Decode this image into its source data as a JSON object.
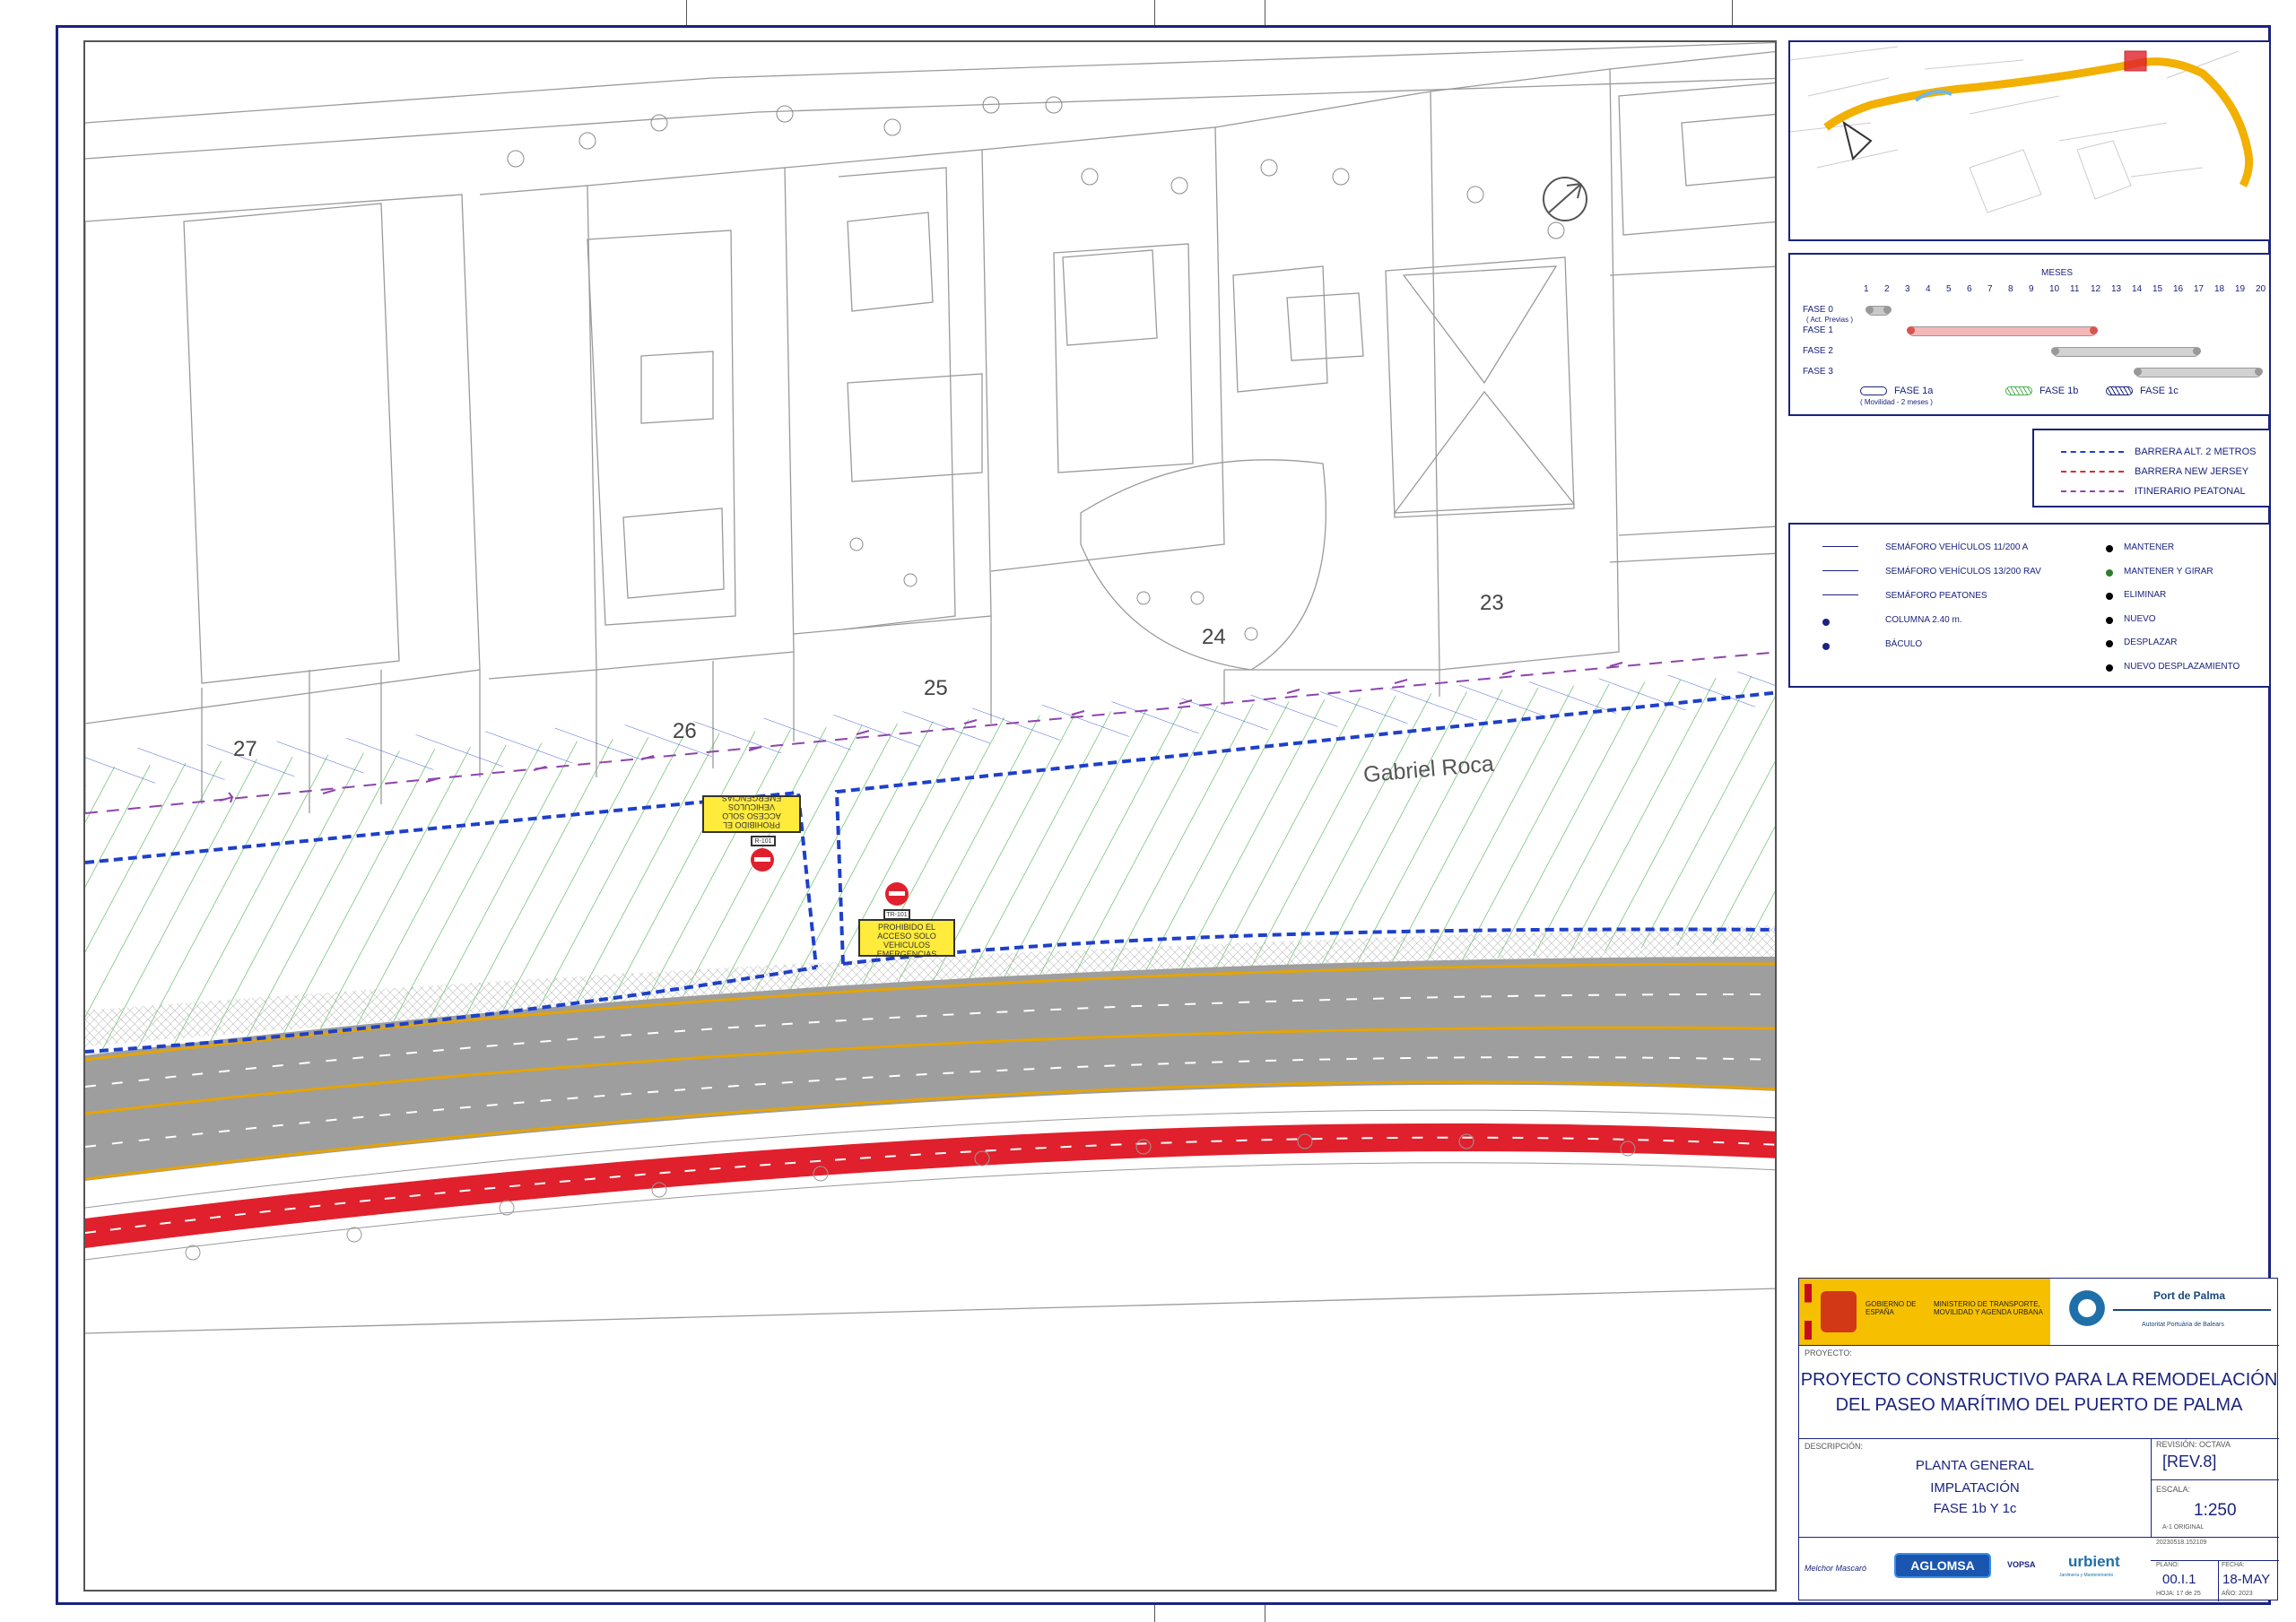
{
  "plan": {
    "lot_labels": [
      "27",
      "26",
      "25",
      "24",
      "23"
    ],
    "street_name": "Gabriel Roca",
    "signs": [
      {
        "code": "R-101",
        "text": "PROHIBIDO EL ACCESO SOLO VEHICULOS EMERGENCIAS"
      },
      {
        "code": "TR-101",
        "text": "PROHIBIDO EL ACCESO SOLO VEHICULOS EMERGENCIAS"
      }
    ]
  },
  "schedule": {
    "months_label": "MESES",
    "months": [
      "1",
      "2",
      "3",
      "4",
      "5",
      "6",
      "7",
      "8",
      "9",
      "10",
      "11",
      "12",
      "13",
      "14",
      "15",
      "16",
      "17",
      "18",
      "19",
      "20"
    ],
    "phases": [
      {
        "label": "FASE 0",
        "sub": "( Act. Previas )",
        "start": 1,
        "end": 2,
        "color": "#c9c9c9"
      },
      {
        "label": "FASE 1",
        "sub": "",
        "start": 3,
        "end": 12,
        "color": "#f2b8b8"
      },
      {
        "label": "FASE 2",
        "sub": "",
        "start": 10,
        "end": 17,
        "color": "#d2d2d2"
      },
      {
        "label": "FASE 3",
        "sub": "",
        "start": 14,
        "end": 20,
        "color": "#d2d2d2"
      }
    ],
    "legend": [
      {
        "label": "FASE 1a",
        "sub": "( Movilidad - 2 meses )"
      },
      {
        "label": "FASE 1b",
        "sub": ""
      },
      {
        "label": "FASE 1c",
        "sub": ""
      }
    ]
  },
  "barriers": [
    {
      "label": "BARRERA ALT. 2 METROS",
      "color": "#1e40c8"
    },
    {
      "label": "BARRERA NEW JERSEY",
      "color": "#d32f2f"
    },
    {
      "label": "ITINERARIO PEATONAL",
      "color": "#8e44ad"
    }
  ],
  "signals_legend": {
    "left": [
      "SEMÁFORO VEHÍCULOS 11/200 A",
      "SEMÁFORO VEHÍCULOS 13/200 RAV",
      "SEMÁFORO PEATONES",
      "COLUMNA 2.40 m.",
      "BÁCULO"
    ],
    "right": [
      {
        "label": "MANTENER",
        "color": "#000000"
      },
      {
        "label": "MANTENER Y GIRAR",
        "color": "#2e7d32"
      },
      {
        "label": "ELIMINAR",
        "color": "#000000"
      },
      {
        "label": "NUEVO",
        "color": "#000000"
      },
      {
        "label": "DESPLAZAR",
        "color": "#000000"
      },
      {
        "label": "NUEVO DESPLAZAMIENTO",
        "color": "#000000"
      }
    ]
  },
  "title_block": {
    "gov1": "GOBIERNO DE ESPAÑA",
    "gov2": "MINISTERIO DE TRANSPORTE, MOVILIDAD Y AGENDA URBANA",
    "port_name": "Port de Palma",
    "port_sub": "Autoritat Portuària de Balears",
    "project_caption": "PROYECTO:",
    "project_line1": "PROYECTO CONSTRUCTIVO PARA LA REMODELACIÓN",
    "project_line2": "DEL PASEO MARÍTIMO DEL PUERTO DE PALMA",
    "description_caption": "DESCRIPCIÓN:",
    "description_lines": [
      "PLANTA GENERAL",
      "IMPLATACIÓN",
      "FASE 1b Y 1c"
    ],
    "revision_caption": "REVISIÓN: OCTAVA",
    "revision": "[REV.8]",
    "scale_caption": "ESCALA:",
    "scale": "1:250",
    "paper": "A-1 ORIGINAL",
    "file_code": "20230518.152109",
    "logos": [
      "Melchor Mascaró",
      "AGLOMSA",
      "VOPSA",
      "urbient"
    ],
    "urbient_sub": "Jardinería y Mantenimiento",
    "plano_caption": "PLANO:",
    "plano": "00.I.1",
    "hoja": "HOJA: 17 de 25",
    "fecha_caption": "FECHA:",
    "fecha": "18-MAY",
    "ano": "AÑO: 2023"
  },
  "colors": {
    "frame": "#1a237e",
    "road": "#9e9e9e",
    "bike_lane": "#e0202c",
    "barrier_blue": "#1e40c8",
    "hatch_green": "#4caf50",
    "pedestrian_purple": "#8e44ad",
    "gov_yellow": "#f6c000"
  }
}
